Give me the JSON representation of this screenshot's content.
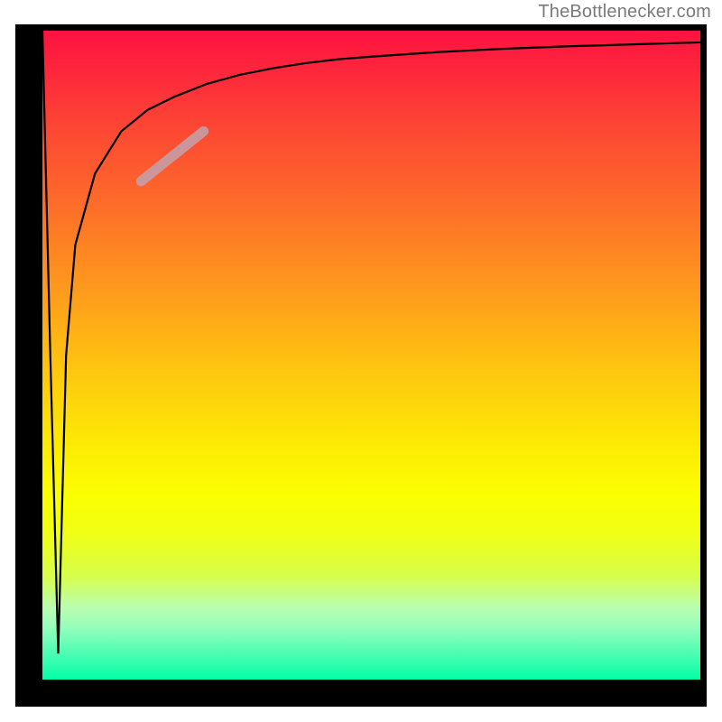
{
  "attribution": "TheBottlenecker.com",
  "colors": {
    "gradient_top": "#fd1240",
    "gradient_bottom": "#02fea7",
    "curve": "#000000",
    "band": "#c79aa0",
    "frame": "#000000"
  },
  "chart_data": {
    "type": "line",
    "title": "",
    "xlabel": "",
    "ylabel": "",
    "x": [
      0.0,
      0.012,
      0.024,
      0.036,
      0.05,
      0.08,
      0.12,
      0.16,
      0.2,
      0.25,
      0.3,
      0.35,
      0.4,
      0.45,
      0.5,
      0.6,
      0.7,
      0.8,
      0.9,
      1.0
    ],
    "values": [
      1.0,
      0.5,
      0.04,
      0.5,
      0.67,
      0.78,
      0.845,
      0.878,
      0.898,
      0.918,
      0.932,
      0.942,
      0.95,
      0.956,
      0.96,
      0.967,
      0.972,
      0.976,
      0.979,
      0.982
    ],
    "xlim": [
      0,
      1
    ],
    "ylim": [
      0,
      1
    ],
    "highlight_band_x": [
      0.15,
      0.245
    ],
    "highlight_band_y": [
      0.768,
      0.845
    ],
    "axes_visible": false,
    "grid": false,
    "background": "vertical red-to-green gradient"
  }
}
